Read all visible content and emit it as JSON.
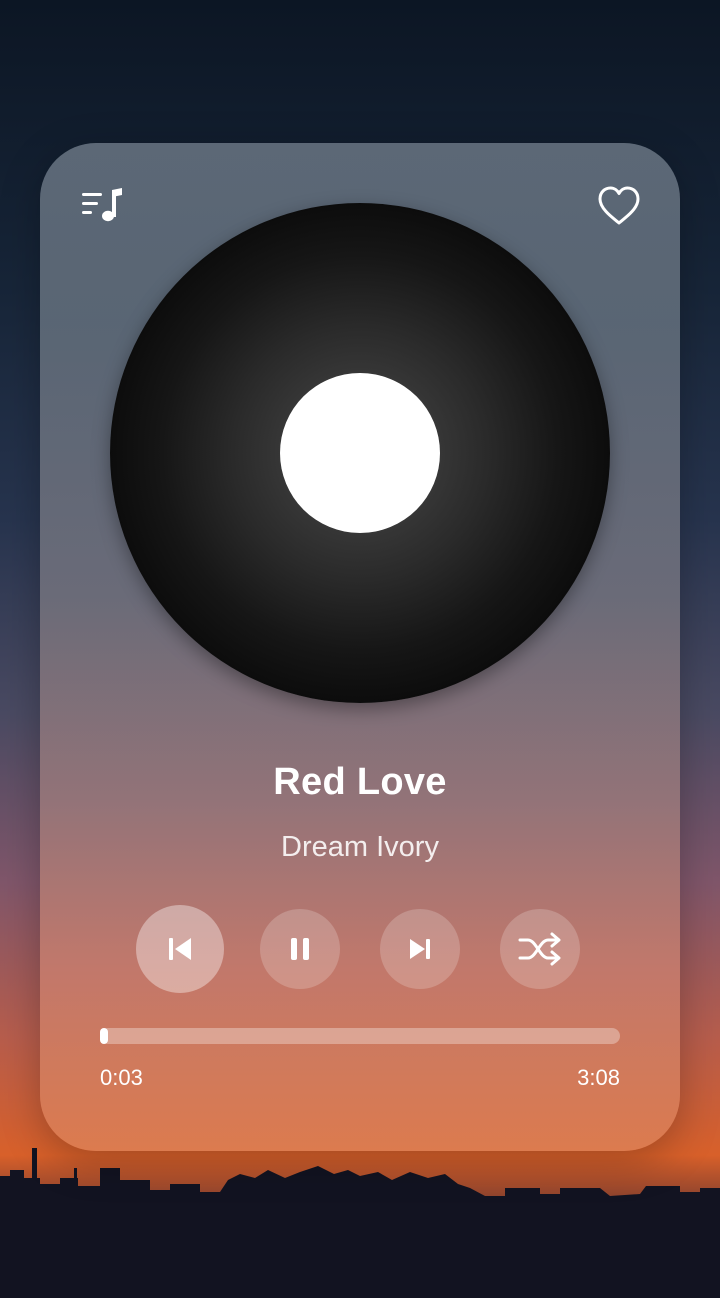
{
  "player": {
    "title": "Red Love",
    "artist": "Dream Ivory",
    "elapsed": "0:03",
    "duration": "3:08",
    "progress_fraction": 0.016
  },
  "icons": {
    "playlist": "playlist-icon",
    "favorite": "heart-icon",
    "previous": "skip-previous-icon",
    "pause": "pause-icon",
    "next": "skip-next-icon",
    "shuffle": "shuffle-icon"
  },
  "colors": {
    "accent": "#ffffff",
    "sunset": "#d8602a",
    "night": "#172538"
  }
}
